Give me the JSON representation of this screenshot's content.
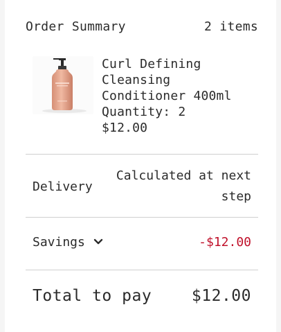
{
  "summary": {
    "title": "Order Summary",
    "item_count": "2 items"
  },
  "product": {
    "name": "Curl Defining Cleansing Conditioner 400ml",
    "quantity": "Quantity: 2",
    "price": "$12.00",
    "image_icon": "product-bottle-image",
    "colors": {
      "bottle": "#e5a78e",
      "pump": "#2a2a2a"
    }
  },
  "delivery": {
    "label": "Delivery",
    "value_line1": "Calculated at next",
    "value_line2": "step"
  },
  "savings": {
    "label": "Savings",
    "icon": "chevron-down-icon",
    "value": "-$12.00",
    "color": "#c0102a"
  },
  "total": {
    "label": "Total to pay",
    "value": "$12.00"
  }
}
